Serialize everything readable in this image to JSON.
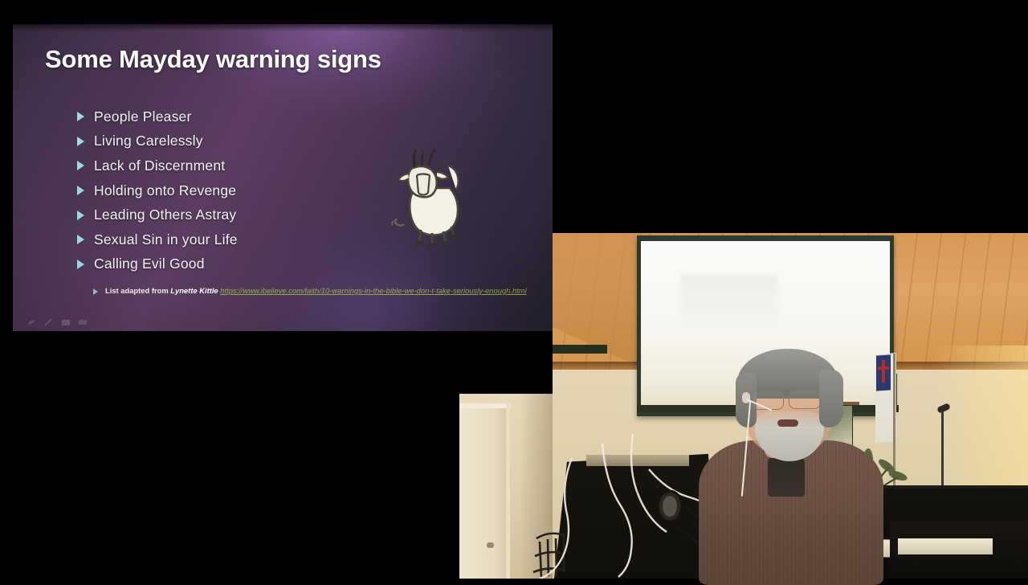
{
  "slide": {
    "title": "Some Mayday warning signs",
    "bullets": [
      {
        "label": "People Pleaser"
      },
      {
        "label": "Living Carelessly"
      },
      {
        "label": "Lack of Discernment"
      },
      {
        "label": "Holding onto Revenge"
      },
      {
        "label": "Leading Others Astray"
      },
      {
        "label": "Sexual Sin in your Life"
      },
      {
        "label": "Calling Evil Good"
      }
    ],
    "footnote": {
      "prefix": "List adapted from ",
      "author": "Lynette Kittle",
      "url": "https://www.ibelieve.com/faith/10-warnings-in-the-bible-we-don-t-take-seriously-enough.html"
    },
    "image": {
      "name": "cartoon-sheep",
      "alt": "Cartoon line-drawing of a sheep"
    },
    "colors": {
      "background_purple": "#4a3452",
      "background_dark": "#262231",
      "title_text": "#fdfdfd",
      "bullet_arrow": "#9fd8de",
      "body_text": "#f3f2f5",
      "link_green": "#9aab55"
    }
  },
  "presenter_toolbar": {
    "items": [
      {
        "name": "pen-pointer-icon"
      },
      {
        "name": "pen-icon"
      },
      {
        "name": "slide-thumbnail-icon"
      },
      {
        "name": "more-options-icon"
      }
    ]
  },
  "video": {
    "label": "Live camera feed of speaker at podium",
    "scene": {
      "speaker": "Man with gray hair, glasses, white beard, headset microphone, wearing a brown ribbed sweater over a dark collared shirt",
      "projection_screen": "Large white projection screen mounted on wall",
      "ceiling": "Pine wood plank vaulted ceiling",
      "flag": "Christian flag on pole",
      "wall_hanging": "Framed tapestry / wall hanging",
      "plant": "Potted palm plant",
      "furniture": "Black piano with white cloth runner",
      "equipment": "Black music stands and audio cabling",
      "door": "Closed interior door on the left wall"
    },
    "colors": {
      "wood_ceiling": "#d99a57",
      "wall": "#ded0ad",
      "screen": "#fbfbfa",
      "sweater": "#6b5044",
      "frame_dark": "#2e3a2b"
    }
  }
}
